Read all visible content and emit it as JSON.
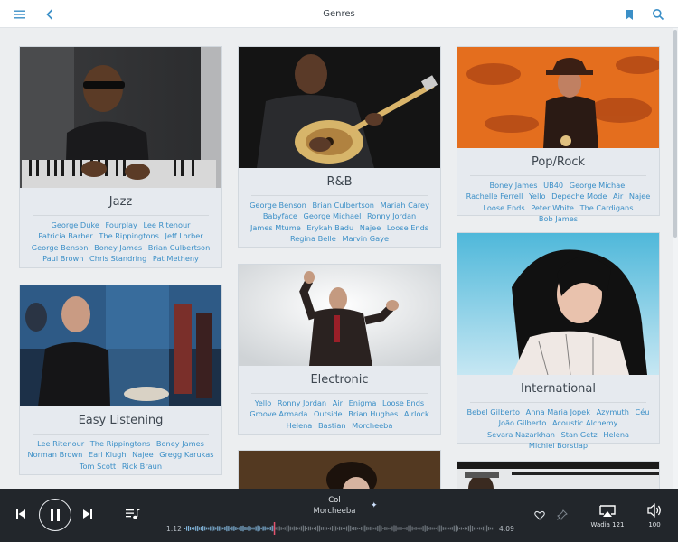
{
  "header": {
    "title": "Genres"
  },
  "genres": [
    {
      "name": "Jazz",
      "artists": [
        "George Duke",
        "Fourplay",
        "Lee Ritenour",
        "Patricia Barber",
        "The Rippingtons",
        "Jeff Lorber",
        "George Benson",
        "Boney James",
        "Brian Culbertson",
        "Paul Brown",
        "Chris Standring",
        "Pat Metheny"
      ]
    },
    {
      "name": "Easy Listening",
      "artists": [
        "Lee Ritenour",
        "The Rippingtons",
        "Boney James",
        "Norman Brown",
        "Earl Klugh",
        "Najee",
        "Gregg Karukas",
        "Tom Scott",
        "Rick Braun"
      ]
    },
    {
      "name": "R&B",
      "artists": [
        "George Benson",
        "Brian Culbertson",
        "Mariah Carey",
        "Babyface",
        "George Michael",
        "Ronny Jordan",
        "James Mtume",
        "Erykah Badu",
        "Najee",
        "Loose Ends",
        "Regina Belle",
        "Marvin Gaye"
      ]
    },
    {
      "name": "Electronic",
      "artists": [
        "Yello",
        "Ronny Jordan",
        "Air",
        "Enigma",
        "Loose Ends",
        "Groove Armada",
        "Outside",
        "Brian Hughes",
        "Airlock",
        "Helena",
        "Bastian",
        "Morcheeba"
      ]
    },
    {
      "name": "Pop/Rock",
      "artists": [
        "Boney James",
        "UB40",
        "George Michael",
        "Rachelle Ferrell",
        "Yello",
        "Depeche Mode",
        "Air",
        "Najee",
        "Loose Ends",
        "Peter White",
        "The Cardigans",
        "Bob James"
      ]
    },
    {
      "name": "International",
      "artists": [
        "Bebel Gilberto",
        "Anna Maria Jopek",
        "Azymuth",
        "Céu",
        "João Gilberto",
        "Acoustic Alchemy",
        "Sevara Nazarkhan",
        "Stan Getz",
        "Helena",
        "Michiel Borstlap"
      ]
    }
  ],
  "player": {
    "track_title": "Col",
    "track_artist": "Morcheeba",
    "time_elapsed": "1:12",
    "time_total": "4:09",
    "progress": 0.289,
    "device_name": "Wadia 121",
    "volume": "100"
  },
  "icons": {
    "menu": "menu-icon",
    "back": "back-arrow-icon",
    "bookmark": "bookmark-icon",
    "search": "search-icon",
    "prev": "skip-previous-icon",
    "pause": "pause-icon",
    "next": "skip-next-icon",
    "queue": "queue-icon",
    "heart": "heart-icon",
    "pin": "pin-icon",
    "airplay": "airplay-icon",
    "volume": "speaker-icon"
  },
  "colors": {
    "accent": "#3b8fc7",
    "player_bg": "#22262b",
    "progress_marker": "#e3536e"
  }
}
